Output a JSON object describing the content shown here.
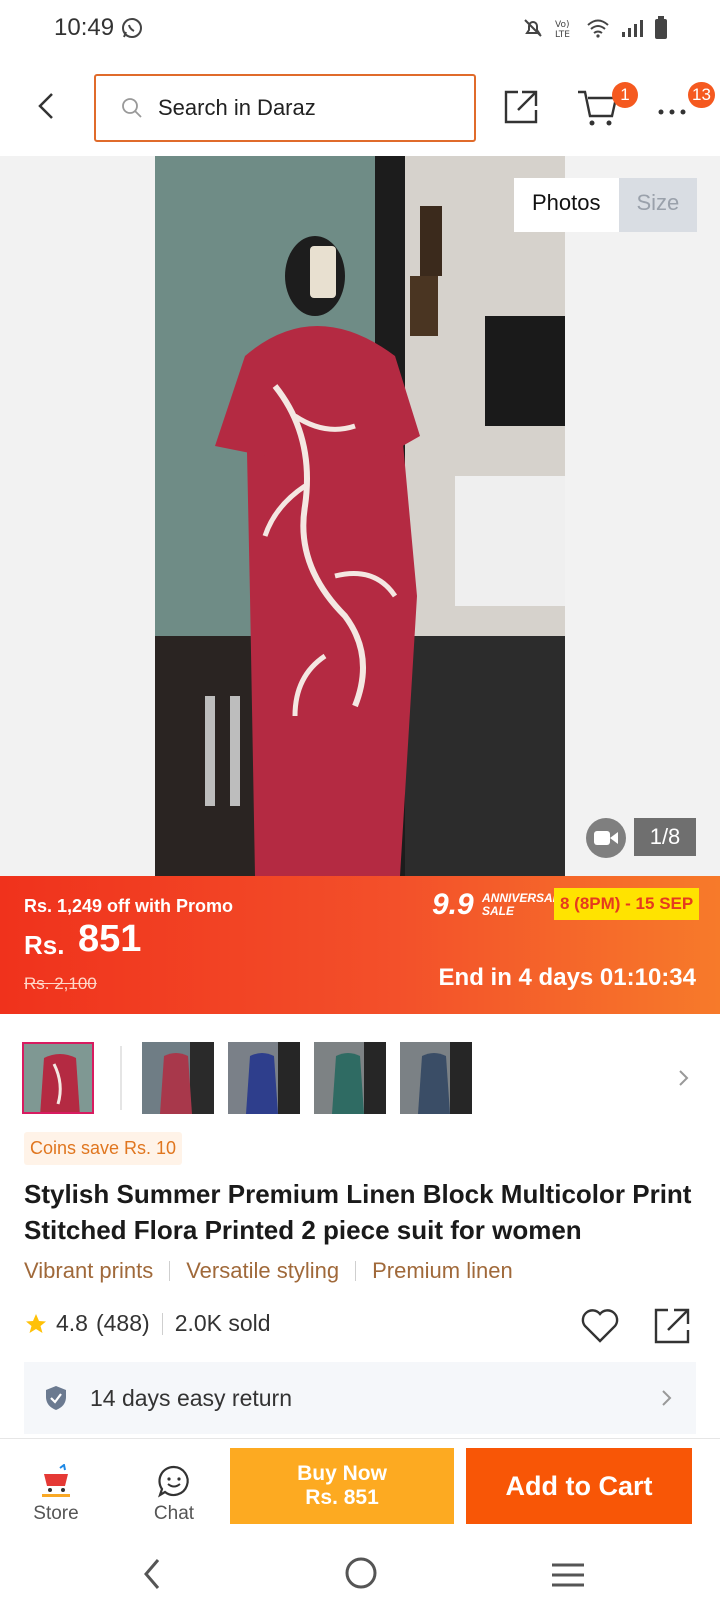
{
  "status_bar": {
    "time": "10:49"
  },
  "header": {
    "search_placeholder": "Search in Daraz",
    "cart_badge": "1",
    "more_badge": "13"
  },
  "gallery": {
    "tab_photos": "Photos",
    "tab_size": "Size",
    "counter": "1/8"
  },
  "promo": {
    "promo_text": "Rs. 1,249 off with Promo",
    "price_prefix": "Rs.",
    "price": "851",
    "original_price": "Rs. 2,100",
    "campaign_number": "9.9",
    "campaign_line1": "ANNIVERSARY",
    "campaign_line2": "SALE",
    "campaign_dates": "8 (8PM) - 15 SEP",
    "countdown": "End in 4 days 01:10:34"
  },
  "product": {
    "coins": "Coins save Rs. 10",
    "title": "Stylish Summer Premium Linen Block Multicolor Print Stitched Flora Printed 2 piece suit for women",
    "tags": [
      "Vibrant prints",
      "Versatile styling",
      "Premium linen"
    ],
    "rating": "4.8",
    "rating_count": "(488)",
    "sold": "2.0K sold",
    "return_policy": "14 days easy return"
  },
  "bottom_bar": {
    "store_label": "Store",
    "chat_label": "Chat",
    "buy_now_line1": "Buy Now",
    "buy_now_line2": "Rs. 851",
    "add_to_cart": "Add to Cart"
  },
  "colors": {
    "brand_orange": "#f85606",
    "buy_now": "#fdaa21",
    "promo_red": "#f0321c",
    "badge": "#f5591f"
  }
}
